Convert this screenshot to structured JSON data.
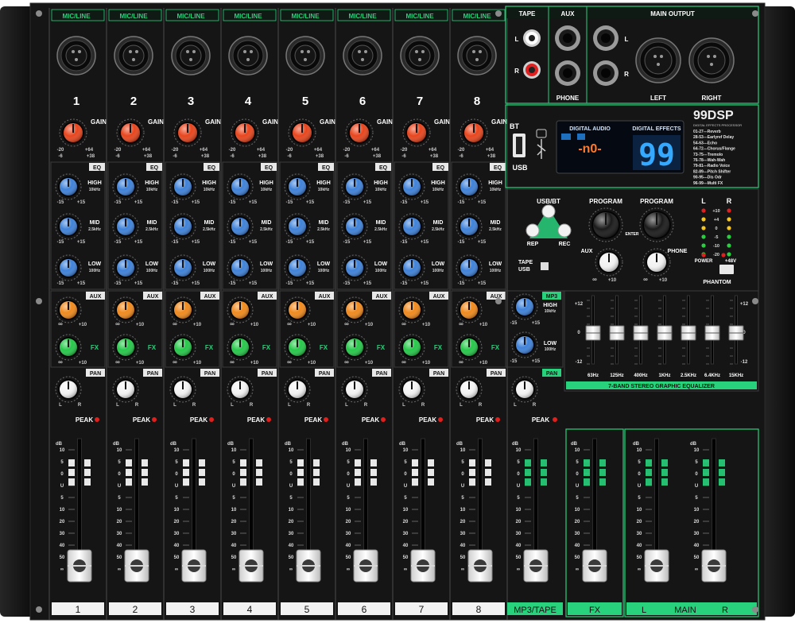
{
  "channels": [
    {
      "number": "1",
      "strip_label": "1"
    },
    {
      "number": "2",
      "strip_label": "2"
    },
    {
      "number": "3",
      "strip_label": "3"
    },
    {
      "number": "4",
      "strip_label": "4"
    },
    {
      "number": "5",
      "strip_label": "5"
    },
    {
      "number": "6",
      "strip_label": "6"
    },
    {
      "number": "7",
      "strip_label": "7"
    },
    {
      "number": "8",
      "strip_label": "8"
    }
  ],
  "channel_labels": {
    "mic_line": "MIC/LINE",
    "gain": "GAIN",
    "gain_scale": {
      "min": "-20",
      "mid": "+64",
      "low": "-6",
      "high": "+38"
    },
    "eq": "EQ",
    "high": "HIGH",
    "high_freq": "10kHz",
    "mid": "MID",
    "mid_freq": "2.5kHz",
    "low": "LOW",
    "low_freq": "100Hz",
    "eq_min": "-15",
    "eq_max": "+15",
    "aux": "AUX",
    "fx": "FX",
    "send_min": "∞",
    "send_max": "+10",
    "pan": "PAN",
    "pan_l": "L",
    "pan_r": "R",
    "peak": "PEAK",
    "db": "dB",
    "fader_scale": [
      "10",
      "5",
      "0",
      "U",
      "5",
      "10",
      "20",
      "30",
      "40",
      "50",
      "∞"
    ]
  },
  "top": {
    "tape": "TAPE",
    "aux": "AUX",
    "main_output": "MAIN OUTPUT",
    "tape_l": "L",
    "tape_r": "R",
    "phone": "PHONE",
    "main_l": "L",
    "main_r": "R",
    "left": "LEFT",
    "right": "RIGHT"
  },
  "dsp": {
    "logo": "99DSP",
    "logo_sub": "DIGITAL EFFECTS PROCESSOR",
    "bt": "BT",
    "usb": "USB",
    "digital_audio": "DIGITAL AUDIO",
    "digital_effects": "DIGITAL EFFECTS",
    "display_audio": "-n0-",
    "display_effects": "99",
    "effects_list": [
      "01-27---Reverb",
      "28-53---Earlyref Delay",
      "54-63---Echo",
      "64-72---Chorus/Flange",
      "73-75---Tremolo",
      "76-78---Wah-Wah",
      "79-81---Radio Voice",
      "82-89---Pitch Shifter",
      "90-95---Dis Odr",
      "96-99---Multi FX"
    ]
  },
  "controls": {
    "usb_bt": "USB/BT",
    "rep": "REP",
    "rec": "REC",
    "program1": "PROGRAM",
    "program2": "PROGRAM",
    "enter": "ENTER",
    "aux": "AUX",
    "phone": "PHONE",
    "scale_inf": "∞",
    "scale_10": "+10",
    "tape_usb": "TAPE\nUSB",
    "tape_label": "TAPE",
    "usb_label": "USB",
    "meter_l": "L",
    "meter_r": "R",
    "meter_scale": [
      "+10",
      "+4",
      "0",
      "-5",
      "-10",
      "-20"
    ],
    "power": "POWER",
    "phantom_48": "+48V",
    "phantom": "PHANTOM"
  },
  "mp3": {
    "label": "MP3",
    "high": "HIGH",
    "high_freq": "10kHz",
    "low": "LOW",
    "low_freq": "100Hz",
    "min": "-15",
    "max": "+15",
    "pan": "PAN",
    "l": "L",
    "r": "R",
    "peak": "PEAK"
  },
  "geq": {
    "title": "7-BAND STEREO GRAPHIC EQUALIZER",
    "bands": [
      "63Hz",
      "125Hz",
      "400Hz",
      "1KHz",
      "2.5KHz",
      "6.4KHz",
      "15KHz"
    ],
    "scale_top": "+12",
    "scale_mid": "0",
    "scale_bot": "-12"
  },
  "bottom_labels": {
    "mp3_tape": "MP3/TAPE",
    "fx": "FX",
    "main": "MAIN",
    "l": "L",
    "r": "R"
  },
  "fader_positions": {
    "channel": [
      0.93,
      0.93,
      0.93,
      0.93,
      0.93,
      0.93,
      0.93,
      0.93
    ],
    "mp3": 0.93,
    "fx": 0.93,
    "main_l": 0.93,
    "main_r": 0.93
  },
  "colors": {
    "panel": "#141414",
    "accent_green": "#28d17c",
    "gain_knob": "#e8461e",
    "eq_knob": "#3f82d9",
    "aux_knob": "#f08a1e",
    "fx_knob": "#27c84a",
    "pan_knob": "#f2f2f2",
    "display_blue": "#35a9ff",
    "display_orange": "#ff7a2a"
  }
}
